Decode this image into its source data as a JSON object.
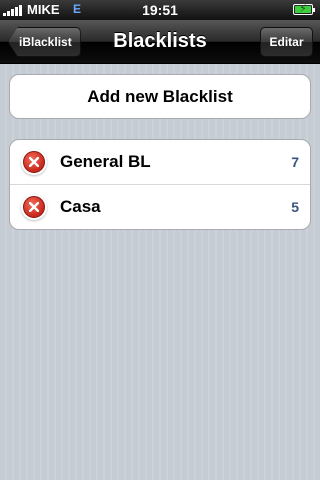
{
  "status_bar": {
    "carrier": "MIKE",
    "network": "E",
    "time": "19:51",
    "signal_bars": 5,
    "battery_state": "charging"
  },
  "nav_bar": {
    "back_label": "iBlacklist",
    "title": "Blacklists",
    "edit_label": "Editar"
  },
  "add_button": {
    "label": "Add new Blacklist"
  },
  "blacklists": [
    {
      "name": "General BL",
      "count": "7"
    },
    {
      "name": "Casa",
      "count": "5"
    }
  ],
  "colors": {
    "delete_red": "#d0342c",
    "count_blue": "#38547f",
    "battery_green": "#3ecf3e"
  }
}
